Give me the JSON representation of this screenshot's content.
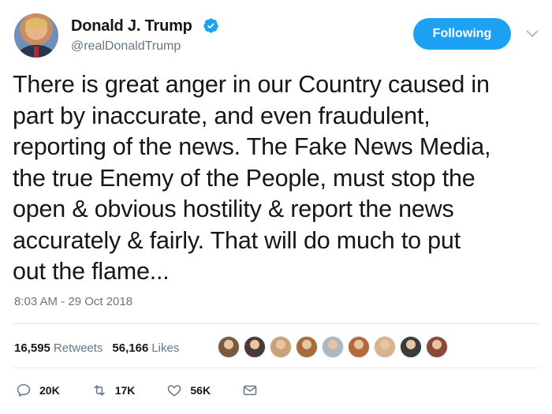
{
  "author": {
    "name": "Donald J. Trump",
    "handle": "@realDonaldTrump"
  },
  "follow_button": {
    "label": "Following"
  },
  "tweet": {
    "lines": [
      "There is great anger in our Country caused in",
      "part by inaccurate, and even fraudulent,",
      "reporting of the news. The Fake News Media,",
      "the true Enemy of the People, must stop the",
      "open & obvious hostility & report the news",
      "accurately & fairly. That will do much to put",
      "out the flame..."
    ],
    "timestamp": "8:03 AM - 29 Oct 2018"
  },
  "stats": {
    "retweets_count": "16,595",
    "retweets_label": "Retweets",
    "likes_count": "56,166",
    "likes_label": "Likes"
  },
  "liker_avatars": [
    "#7a5a3e",
    "#4a3a35",
    "#c9a27a",
    "#a86b3c",
    "#aab8c2",
    "#b5683a",
    "#d8b48c",
    "#3b3b3b",
    "#8a4a3a"
  ],
  "actions": {
    "reply": "20K",
    "retweet": "17K",
    "like": "56K"
  },
  "colors": {
    "accent": "#1da1f2",
    "muted": "#657786",
    "text": "#14171a"
  }
}
